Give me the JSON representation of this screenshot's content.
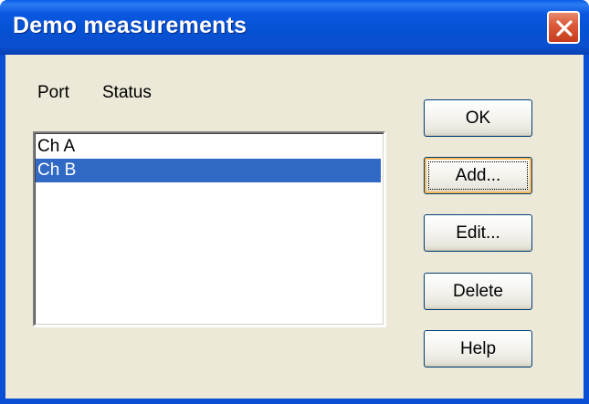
{
  "window": {
    "title": "Demo measurements"
  },
  "list": {
    "headers": {
      "port": "Port",
      "status": "Status"
    },
    "items": [
      {
        "label": "Ch A"
      },
      {
        "label": "Ch B"
      }
    ],
    "selected_index": 1
  },
  "buttons": {
    "ok": "OK",
    "add": "Add...",
    "edit": "Edit...",
    "delete": "Delete",
    "help": "Help"
  },
  "icons": {
    "close": "close-icon"
  },
  "colors": {
    "titlebar": "#0a58e0",
    "selection": "#316ac5",
    "dialog_bg": "#ece9d8",
    "close_button": "#dc5b3a"
  }
}
